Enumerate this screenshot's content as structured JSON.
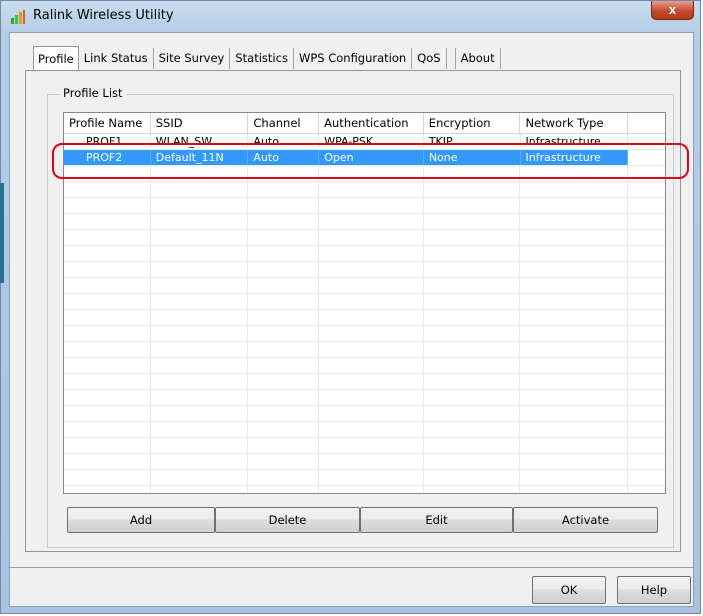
{
  "window": {
    "title": "Ralink Wireless Utility",
    "close_label": "x"
  },
  "tabs": [
    {
      "label": "Profile",
      "active": true
    },
    {
      "label": "Link Status",
      "active": false
    },
    {
      "label": "Site Survey",
      "active": false
    },
    {
      "label": "Statistics",
      "active": false
    },
    {
      "label": "WPS Configuration",
      "active": false
    },
    {
      "label": "QoS",
      "active": false
    },
    {
      "label": "About",
      "active": false
    }
  ],
  "profile_list": {
    "group_label": "Profile List",
    "columns": [
      "Profile Name",
      "SSID",
      "Channel",
      "Authentication",
      "Encryption",
      "Network Type"
    ],
    "rows": [
      {
        "profile_name": "PROF1",
        "ssid": "WLAN_SW",
        "channel": "Auto",
        "authentication": "WPA-PSK",
        "encryption": "TKIP",
        "network_type": "Infrastructure",
        "selected": false
      },
      {
        "profile_name": "PROF2",
        "ssid": "Default_11N",
        "channel": "Auto",
        "authentication": "Open",
        "encryption": "None",
        "network_type": "Infrastructure",
        "selected": true
      }
    ]
  },
  "buttons": {
    "add": "Add",
    "delete": "Delete",
    "edit": "Edit",
    "activate": "Activate",
    "ok": "OK",
    "help": "Help"
  },
  "colors": {
    "selection": "#3399ff",
    "highlight_ring": "#e0001a",
    "title_gradient": "#c9dcef"
  }
}
